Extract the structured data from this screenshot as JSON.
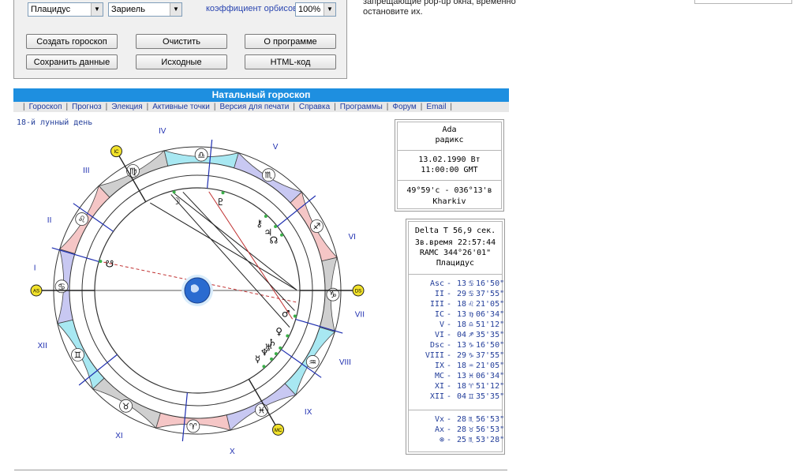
{
  "form": {
    "house_system": "Плацидус",
    "interpretation": "Зариель",
    "orbs_label": "коэффициент орбисов",
    "orbs_value": "100%",
    "buttons": {
      "create": "Создать гороскоп",
      "clear": "Очистить",
      "about": "О программе",
      "save": "Сохранить данные",
      "source": "Исходные",
      "html": "HTML-код"
    }
  },
  "popup_note": {
    "line1": "запрещающие pop-up окна, временно",
    "line2": "остановите их."
  },
  "header": {
    "title": "Натальный гороскоп",
    "menu": [
      "Гороскоп",
      "Прогноз",
      "Элекция",
      "Активные точки",
      "Версия для печати",
      "Справка",
      "Программы",
      "Форум",
      "Email"
    ]
  },
  "lunar_day": "18-й лунный день",
  "info": {
    "name": "Ada",
    "chart_type": "радикс",
    "date": "13.02.1990 Вт",
    "time": "11:00:00 GMT",
    "coords": "49°59'с - 036°13'в",
    "city": "Kharkiv",
    "delta_t": "Delta T  56,9 сек.",
    "sidereal": "Зв.время 22:57:44",
    "ramc": "RAMC 344°26'01\"",
    "system": "Плацидус"
  },
  "cusps": [
    {
      "name": "Asc",
      "deg": "13",
      "sign": "♋",
      "min": "16'50\""
    },
    {
      "name": "II",
      "deg": "29",
      "sign": "♋",
      "min": "37'55\""
    },
    {
      "name": "III",
      "deg": "18",
      "sign": "♌",
      "min": "21'05\""
    },
    {
      "name": "IC",
      "deg": "13",
      "sign": "♍",
      "min": "06'34\""
    },
    {
      "name": "V",
      "deg": "18",
      "sign": "♎",
      "min": "51'12\""
    },
    {
      "name": "VI",
      "deg": "04",
      "sign": "♐",
      "min": "35'35\""
    },
    {
      "name": "Dsc",
      "deg": "13",
      "sign": "♑",
      "min": "16'50\""
    },
    {
      "name": "VIII",
      "deg": "29",
      "sign": "♑",
      "min": "37'55\""
    },
    {
      "name": "IX",
      "deg": "18",
      "sign": "♒",
      "min": "21'05\""
    },
    {
      "name": "MC",
      "deg": "13",
      "sign": "♓",
      "min": "06'34\""
    },
    {
      "name": "XI",
      "deg": "18",
      "sign": "♈",
      "min": "51'12\""
    },
    {
      "name": "XII",
      "deg": "04",
      "sign": "♊",
      "min": "35'35\""
    }
  ],
  "extra_points": [
    {
      "name": "Vx",
      "deg": "28",
      "sign": "♏",
      "min": "56'53\""
    },
    {
      "name": "Ax",
      "deg": "28",
      "sign": "♉",
      "min": "56'53\""
    },
    {
      "name": "⊗",
      "deg": "25",
      "sign": "♏",
      "min": "53'28\""
    }
  ],
  "chart": {
    "house_labels": [
      "I",
      "II",
      "III",
      "IV",
      "V",
      "VI",
      "VII",
      "VIII",
      "IX",
      "X",
      "XI",
      "XII"
    ],
    "angle_labels": {
      "asc": "AS",
      "ds": "DS",
      "mc": "MC",
      "ic": "IC"
    },
    "sign_glyphs": [
      "♈",
      "♉",
      "♊",
      "♋",
      "♌",
      "♍",
      "♎",
      "♏",
      "♐",
      "♑",
      "♒",
      "♓"
    ],
    "colors": {
      "fire": "#f5c6c6",
      "earth": "#cfcfcf",
      "air": "#a8e8f2",
      "water": "#c8c8f2",
      "accent": "#1e8fe0"
    }
  }
}
